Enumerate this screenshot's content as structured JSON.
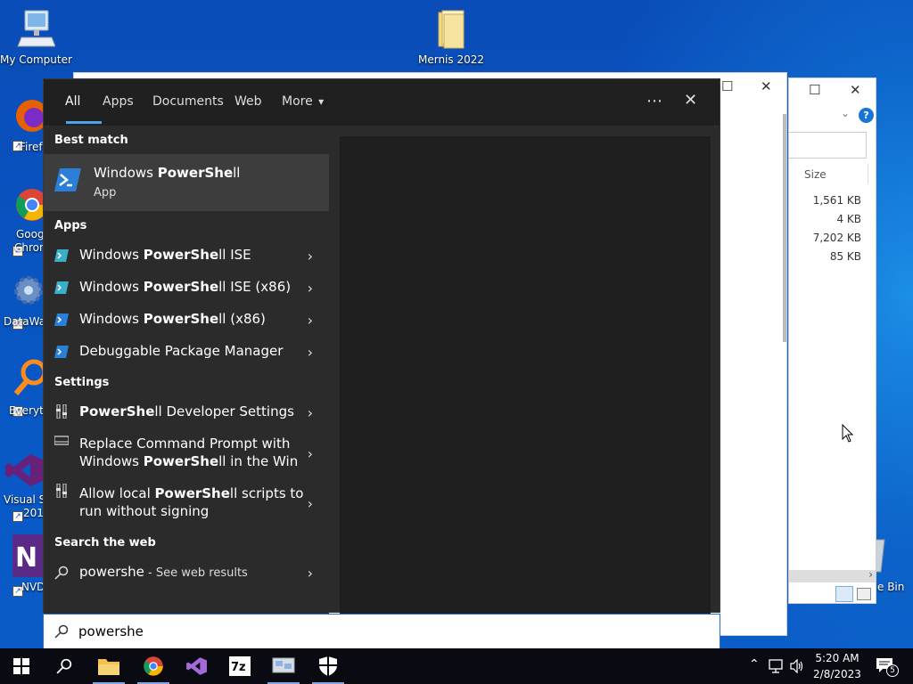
{
  "desktop": {
    "icons": [
      {
        "label": "My Computer"
      },
      {
        "label": "Mernis 2022"
      },
      {
        "label": "Firefo"
      },
      {
        "label": "Goog"
      },
      {
        "label": "Chron"
      },
      {
        "label": "DataWa"
      },
      {
        "label": "Everyth"
      },
      {
        "label": "Visual St"
      },
      {
        "label": "201"
      },
      {
        "label": "NVD"
      },
      {
        "label": "e Bin"
      }
    ]
  },
  "explorer_bg": {
    "column_size": "Size",
    "sizes": [
      "1,561 KB",
      "4 KB",
      "7,202 KB",
      "85 KB"
    ]
  },
  "search": {
    "tabs": [
      "All",
      "Apps",
      "Documents",
      "Web",
      "More"
    ],
    "more_caret": "▾",
    "options_icon": "⋯",
    "close_icon": "✕",
    "best_match_header": "Best match",
    "best_match": {
      "pre": "Windows ",
      "bold": "PowerShe",
      "post": "ll",
      "type": "App"
    },
    "apps_header": "Apps",
    "apps": [
      {
        "pre": "Windows ",
        "bold": "PowerShe",
        "post": "ll ISE"
      },
      {
        "pre": "Windows ",
        "bold": "PowerShe",
        "post": "ll ISE (x86)"
      },
      {
        "pre": "Windows ",
        "bold": "PowerShe",
        "post": "ll (x86)"
      },
      {
        "pre": "Debuggable Package Manager",
        "bold": "",
        "post": ""
      }
    ],
    "settings_header": "Settings",
    "settings": [
      {
        "line1_pre": "",
        "line1_bold": "PowerShe",
        "line1_post": "ll Developer Settings",
        "line2_pre": "",
        "line2_bold": "",
        "line2_post": ""
      },
      {
        "line1_pre": "Replace Command Prompt with",
        "line1_bold": "",
        "line1_post": "",
        "line2_pre": "Windows ",
        "line2_bold": "PowerShe",
        "line2_post": "ll in the Win"
      },
      {
        "line1_pre": "Allow local ",
        "line1_bold": "PowerShe",
        "line1_post": "ll scripts to",
        "line2_pre": "run without signing",
        "line2_bold": "",
        "line2_post": ""
      }
    ],
    "web_header": "Search the web",
    "web_query": "powershe",
    "web_suffix": " - See web results",
    "box_value": "powershe",
    "chevron": "›"
  },
  "taskbar": {
    "apps": [
      "start-button",
      "search-button",
      "file-explorer",
      "chrome",
      "visual-studio",
      "7zip",
      "network-app",
      "defender"
    ],
    "time": "5:20 AM",
    "date": "2/8/2023",
    "notification_count": "5"
  },
  "colors": {
    "accent": "#4ea3ee",
    "panel": "#2b2b2b",
    "tabbar": "#202020",
    "preview": "#1f1f1f",
    "taskbar": "#0a0a12"
  }
}
